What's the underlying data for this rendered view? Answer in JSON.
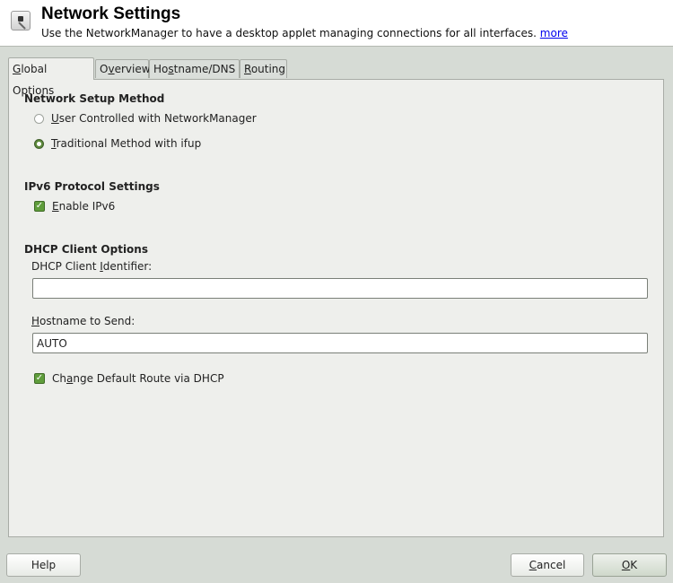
{
  "header": {
    "title": "Network Settings",
    "subtitle": "Use the NetworkManager to have a desktop applet managing connections for all interfaces.",
    "more_link": "more",
    "icon": "network-settings-icon"
  },
  "tabs": [
    {
      "label_u": "G",
      "label_rest": "lobal Options",
      "active": true
    },
    {
      "label_pre": "O",
      "label_u": "v",
      "label_rest": "erview",
      "active": false
    },
    {
      "label_pre": "Ho",
      "label_u": "s",
      "label_rest": "tname/DNS",
      "active": false
    },
    {
      "label_u": "R",
      "label_rest": "outing",
      "active": false
    }
  ],
  "network_setup": {
    "title": "Network Setup Method",
    "options": [
      {
        "u": "U",
        "rest": "ser Controlled with NetworkManager",
        "selected": false
      },
      {
        "u": "T",
        "rest": "raditional Method with ifup",
        "selected": true
      }
    ]
  },
  "ipv6": {
    "title": "IPv6 Protocol Settings",
    "enable": {
      "u": "E",
      "rest": "nable IPv6",
      "checked": true
    }
  },
  "dhcp": {
    "title": "DHCP Client Options",
    "identifier_label_pre": "DHCP Client ",
    "identifier_label_u": "I",
    "identifier_label_rest": "dentifier:",
    "identifier_value": "",
    "hostname_label_u": "H",
    "hostname_label_rest": "ostname to Send:",
    "hostname_value": "AUTO",
    "default_route": {
      "pre": "Ch",
      "u": "a",
      "rest": "nge Default Route via DHCP",
      "checked": true
    }
  },
  "buttons": {
    "help": "Help",
    "cancel_u": "C",
    "cancel_rest": "ancel",
    "ok_u": "O",
    "ok_rest": "K"
  },
  "colors": {
    "accent_green": "#5d8a3b",
    "link": "#0000ee"
  }
}
